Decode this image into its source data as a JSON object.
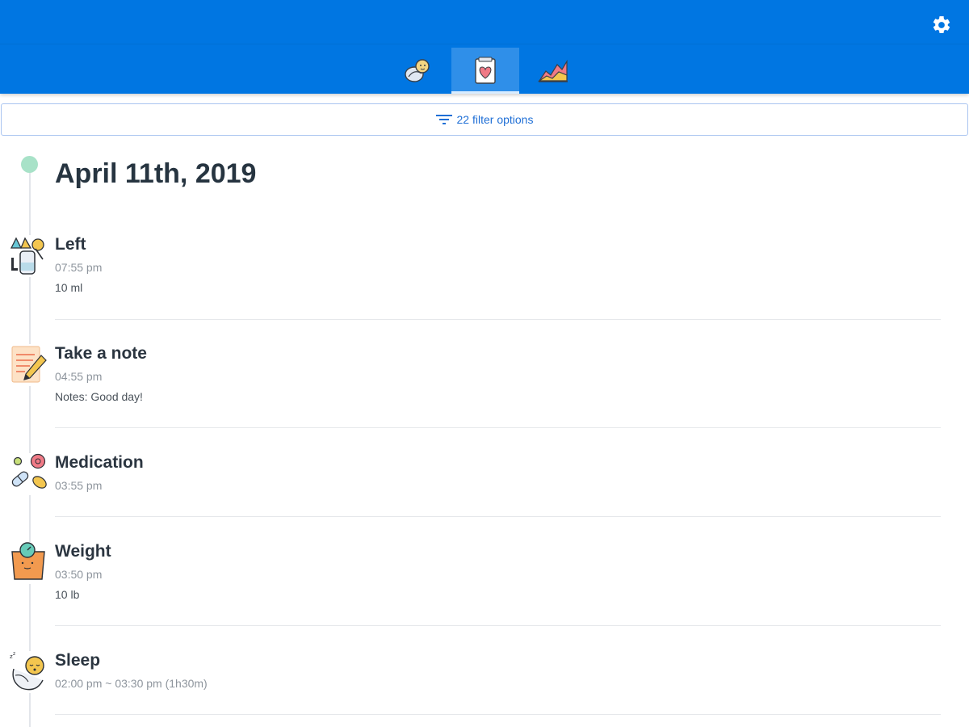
{
  "header": {
    "settings_icon": "gear-icon",
    "tabs": [
      {
        "icon": "baby-swaddle-icon",
        "active": false
      },
      {
        "icon": "heart-note-icon",
        "active": true
      },
      {
        "icon": "area-chart-icon",
        "active": false
      }
    ],
    "colors": {
      "bar": "#0076e2",
      "active_tab": "#2f8fe9"
    }
  },
  "filter": {
    "icon": "filter-icon",
    "label": "22 filter options"
  },
  "timeline": {
    "date": "April 11th, 2019",
    "dot_color": "#a8e2c8",
    "entries": [
      {
        "icon": "breast-pump-icon",
        "title": "Left",
        "time": "07:55 pm",
        "detail": "10 ml"
      },
      {
        "icon": "notepad-pencil-icon",
        "title": "Take a note",
        "time": "04:55 pm",
        "detail": "Notes: Good day!"
      },
      {
        "icon": "pills-icon",
        "title": "Medication",
        "time": "03:55 pm",
        "detail": ""
      },
      {
        "icon": "scale-icon",
        "title": "Weight",
        "time": "03:50 pm",
        "detail": "10 lb"
      },
      {
        "icon": "sleeping-baby-icon",
        "title": "Sleep",
        "time": "02:00 pm ~ 03:30 pm (1h30m)",
        "detail": ""
      }
    ]
  }
}
